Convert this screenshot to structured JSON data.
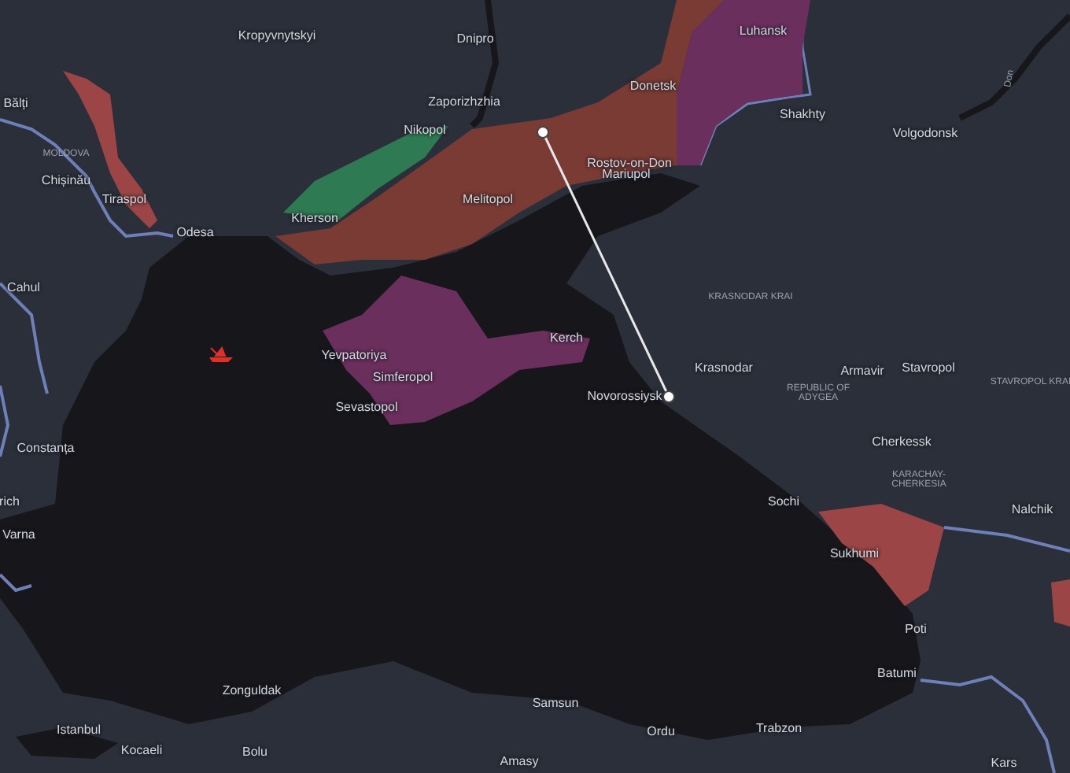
{
  "map": {
    "labels": [
      {
        "text": "Kropyvnytskyi",
        "kind": "city"
      },
      {
        "text": "Dnipro",
        "kind": "city"
      },
      {
        "text": "Zaporizhzhia",
        "kind": "city"
      },
      {
        "text": "Nikopol",
        "kind": "city"
      },
      {
        "text": "Donetsk",
        "kind": "city"
      },
      {
        "text": "Luhansk",
        "kind": "city"
      },
      {
        "text": "Shakhty",
        "kind": "city"
      },
      {
        "text": "Volgodonsk",
        "kind": "city"
      },
      {
        "text": "Don",
        "kind": "river"
      },
      {
        "text": "Rostov-on-Don",
        "kind": "city"
      },
      {
        "text": "Mariupol",
        "kind": "city"
      },
      {
        "text": "Melitopol",
        "kind": "city"
      },
      {
        "text": "Kherson",
        "kind": "city"
      },
      {
        "text": "Odesa",
        "kind": "city"
      },
      {
        "text": "Bălți",
        "kind": "city"
      },
      {
        "text": "MOLDOVA",
        "kind": "region"
      },
      {
        "text": "Chișinău",
        "kind": "city"
      },
      {
        "text": "Tiraspol",
        "kind": "city"
      },
      {
        "text": "Cahul",
        "kind": "city"
      },
      {
        "text": "KRASNODAR KRAI",
        "kind": "region"
      },
      {
        "text": "Kerch",
        "kind": "city"
      },
      {
        "text": "Yevpatoriya",
        "kind": "city"
      },
      {
        "text": "Simferopol",
        "kind": "city"
      },
      {
        "text": "Sevastopol",
        "kind": "city"
      },
      {
        "text": "Krasnodar",
        "kind": "city"
      },
      {
        "text": "Armavir",
        "kind": "city"
      },
      {
        "text": "Stavropol",
        "kind": "city"
      },
      {
        "text": "STAVROPOL KRAI",
        "kind": "region"
      },
      {
        "text": "Novorossiysk",
        "kind": "city"
      },
      {
        "text": "REPUBLIC OF ADYGEA",
        "kind": "region"
      },
      {
        "text": "Constanța",
        "kind": "city"
      },
      {
        "text": "Cherkessk",
        "kind": "city"
      },
      {
        "text": "KARACHAY-CHERKESIA",
        "kind": "region"
      },
      {
        "text": "rich",
        "kind": "city"
      },
      {
        "text": "Sochi",
        "kind": "city"
      },
      {
        "text": "Nalchik",
        "kind": "city"
      },
      {
        "text": "Varna",
        "kind": "city"
      },
      {
        "text": "Sukhumi",
        "kind": "city"
      },
      {
        "text": "Poti",
        "kind": "city"
      },
      {
        "text": "Batumi",
        "kind": "city"
      },
      {
        "text": "Zonguldak",
        "kind": "city"
      },
      {
        "text": "Samsun",
        "kind": "city"
      },
      {
        "text": "Istanbul",
        "kind": "city"
      },
      {
        "text": "Ordu",
        "kind": "city"
      },
      {
        "text": "Trabzon",
        "kind": "city"
      },
      {
        "text": "Kocaeli",
        "kind": "city"
      },
      {
        "text": "Bolu",
        "kind": "city"
      },
      {
        "text": "Amasy",
        "kind": "city"
      },
      {
        "text": "Kars",
        "kind": "city"
      }
    ],
    "zones": [
      {
        "color": "#7a3b34"
      },
      {
        "color": "#2e7a52"
      },
      {
        "color": "#6b2f5e"
      },
      {
        "color": "#6b2f5e"
      },
      {
        "color": "#9b4546"
      },
      {
        "color": "#9b4546"
      },
      {
        "color": "#9b4546"
      }
    ]
  }
}
